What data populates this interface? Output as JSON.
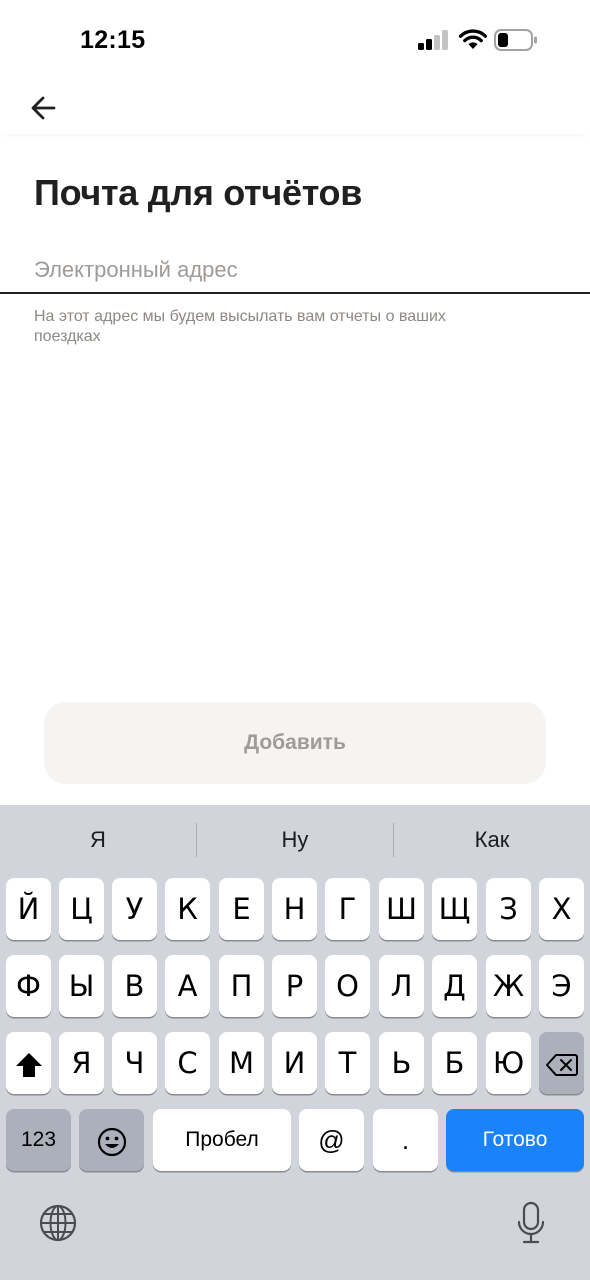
{
  "status_bar": {
    "time": "12:15",
    "icons": [
      "cellular-signal-icon",
      "wifi-icon",
      "battery-icon"
    ]
  },
  "header": {
    "back_icon": "arrow-left-icon"
  },
  "page": {
    "title": "Почта для отчётов",
    "email_field": {
      "value": "",
      "placeholder": "Электронный адрес"
    },
    "hint": "На этот адрес мы будем высылать вам отчеты о ваших поездках",
    "add_button_label": "Добавить"
  },
  "keyboard": {
    "suggestions": [
      "Я",
      "Ну",
      "Как"
    ],
    "row1": [
      "Й",
      "Ц",
      "У",
      "К",
      "Е",
      "Н",
      "Г",
      "Ш",
      "Щ",
      "З",
      "Х"
    ],
    "row2": [
      "Ф",
      "Ы",
      "В",
      "А",
      "П",
      "Р",
      "О",
      "Л",
      "Д",
      "Ж",
      "Э"
    ],
    "row3": [
      "Я",
      "Ч",
      "С",
      "М",
      "И",
      "Т",
      "Ь",
      "Б",
      "Ю"
    ],
    "numbers_key": "123",
    "space_key": "Пробел",
    "at_key": "@",
    "dot_key": ".",
    "done_key": "Готово",
    "icons": [
      "shift-icon",
      "backspace-icon",
      "emoji-icon",
      "globe-icon",
      "microphone-icon"
    ]
  },
  "colors": {
    "accent": "#1a82fb",
    "keyboard_bg": "#d1d4db",
    "button_bg": "#f5f4f2",
    "text_primary": "#21201f",
    "text_secondary": "#8c8884"
  }
}
